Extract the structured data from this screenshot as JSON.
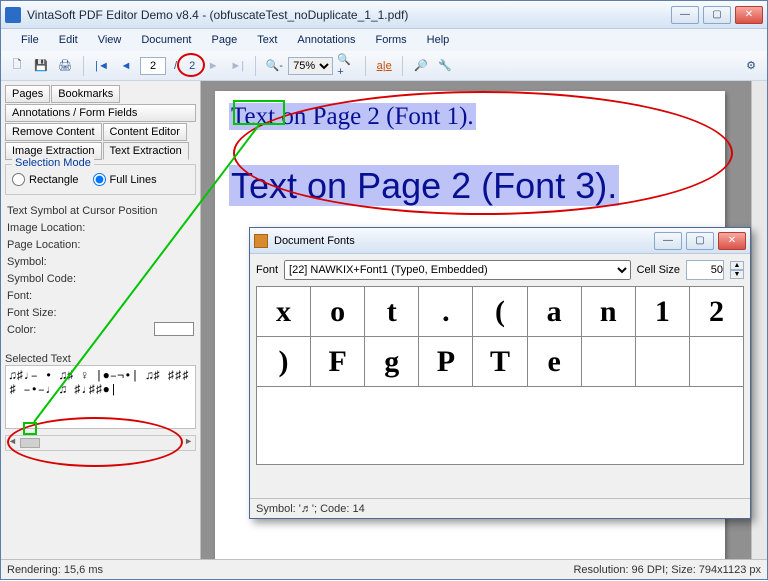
{
  "window": {
    "title": "VintaSoft PDF Editor Demo v8.4 -  (obfuscateTest_noDuplicate_1_1.pdf)"
  },
  "menu": {
    "file": "File",
    "edit": "Edit",
    "view": "View",
    "document": "Document",
    "page": "Page",
    "text": "Text",
    "annotations": "Annotations",
    "forms": "Forms",
    "help": "Help"
  },
  "toolbar": {
    "page_current": "2",
    "page_sep": "/",
    "page_total": "2",
    "zoom": "75%"
  },
  "sidebar": {
    "tabs": {
      "pages": "Pages",
      "bookmarks": "Bookmarks",
      "annot": "Annotations / Form Fields",
      "remove": "Remove Content",
      "content": "Content Editor",
      "imgex": "Image Extraction",
      "textex": "Text Extraction"
    },
    "selection_mode_title": "Selection Mode",
    "radio_rect": "Rectangle",
    "radio_full": "Full Lines",
    "cursor_title": "Text Symbol at Cursor Position",
    "img_loc": "Image Location:",
    "page_loc": "Page Location:",
    "symbol": "Symbol:",
    "symbol_code": "Symbol Code:",
    "font": "Font:",
    "font_size": "Font Size:",
    "color": "Color:",
    "selected_text_title": "Selected Text",
    "selected_text_lines": "♫♯♩– •     ♫♯ ♀ |●–¬•|\n♫♯ ♯♯♯ ♯ –•–♩    ♫   ♯♩♯♯●|"
  },
  "page": {
    "line1": "Text on Page 2 (Font 1).",
    "line2": "Text on Page 2 (Font 3)."
  },
  "dialog": {
    "title": "Document Fonts",
    "font_label": "Font",
    "font_value": "[22] NAWKIX+Font1 (Type0, Embedded)",
    "cell_size_label": "Cell Size",
    "cell_size_value": "50",
    "glyphs_row1": [
      "x",
      "o",
      "t",
      ".",
      "(",
      "a",
      "n",
      "1",
      "2"
    ],
    "glyphs_row2": [
      ")",
      "F",
      "g",
      "P",
      "T",
      "e",
      "",
      "",
      ""
    ],
    "status": "Symbol: '♬'; Code: 14"
  },
  "status": {
    "left": "Rendering: 15,6 ms",
    "right": "Resolution: 96 DPI; Size: 794x1123 px"
  }
}
